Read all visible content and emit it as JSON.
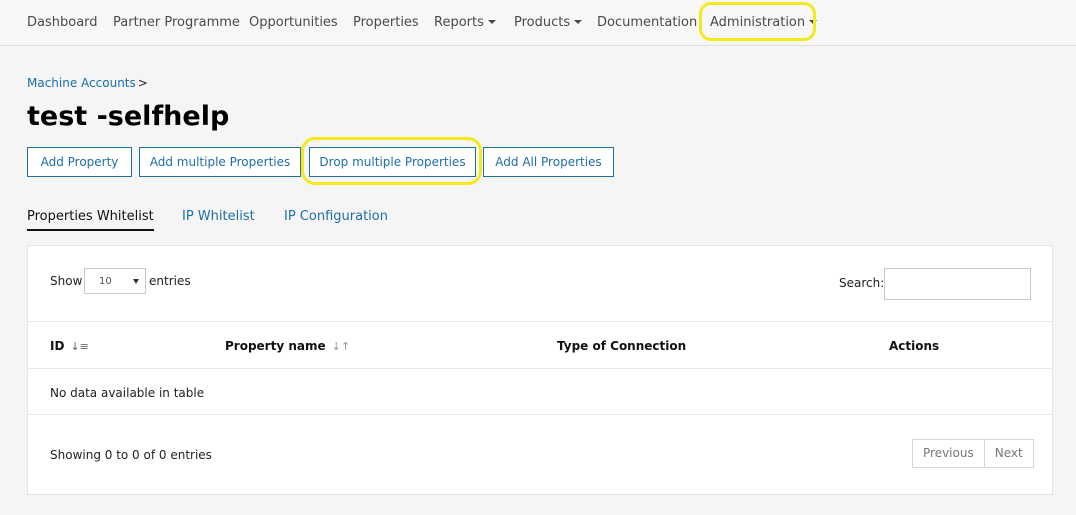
{
  "nav": {
    "items": [
      {
        "label": "Dashboard"
      },
      {
        "label": "Partner Programme"
      },
      {
        "label": "Opportunities"
      },
      {
        "label": "Properties"
      },
      {
        "label": "Reports",
        "dropdown": true
      },
      {
        "label": "Products",
        "dropdown": true
      },
      {
        "label": "Documentation"
      },
      {
        "label": "Administration",
        "dropdown": true
      }
    ]
  },
  "breadcrumb": {
    "label": "Machine Accounts",
    "separator": ">"
  },
  "page": {
    "title": "test -selfhelp"
  },
  "actions": {
    "add_property": "Add Property",
    "add_multiple": "Add multiple Properties",
    "drop_multiple": "Drop multiple Properties",
    "add_all": "Add All Properties"
  },
  "tabs": [
    {
      "label": "Properties Whitelist",
      "active": true
    },
    {
      "label": "IP Whitelist",
      "active": false
    },
    {
      "label": "IP Configuration",
      "active": false
    }
  ],
  "table": {
    "show_label": "Show",
    "page_size": "10",
    "entries_label": "entries",
    "search_label": "Search:",
    "search_value": "",
    "columns": [
      "ID",
      "Property name",
      "Type of Connection",
      "Actions"
    ],
    "empty_message": "No data available in table",
    "info": "Showing 0 to 0 of 0 entries",
    "pager": {
      "previous": "Previous",
      "next": "Next"
    }
  },
  "colors": {
    "link": "#1f6fa7",
    "highlight": "#f2ea1c",
    "nav_text": "#4a4a4a"
  }
}
